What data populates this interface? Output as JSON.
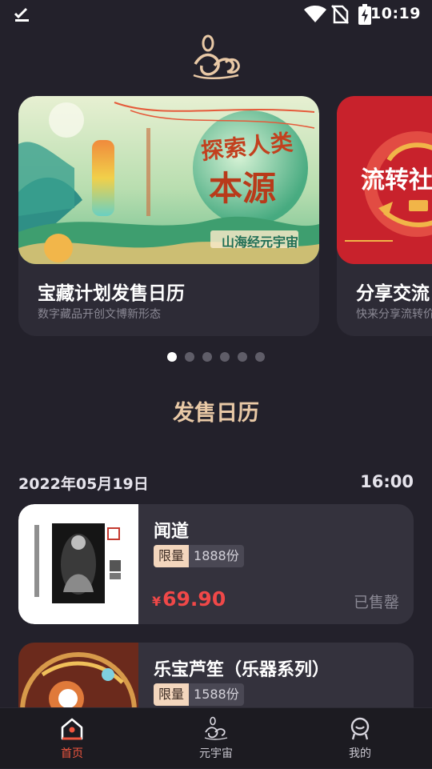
{
  "status_bar": {
    "time": "10:19"
  },
  "carousel": {
    "cards": [
      {
        "title": "宝藏计划发售日历",
        "subtitle": "数字藏品开创文博新形态",
        "banner_line1": "探索人类",
        "banner_line2": "本源",
        "banner_caption": "山海经元宇宙"
      },
      {
        "title": "分享交流",
        "subtitle": "快来分享流转价",
        "banner_line1": "流转社"
      }
    ],
    "page_count": 6,
    "active_index": 0
  },
  "section": {
    "title": "发售日历"
  },
  "schedule": {
    "date": "2022年05月19日",
    "time": "16:00"
  },
  "products": [
    {
      "name": "闻道",
      "limit_tag": "限量",
      "quantity": "1888份",
      "currency": "¥",
      "price": "69.90",
      "status": "已售罄"
    },
    {
      "name": "乐宝芦笙（乐器系列）",
      "limit_tag": "限量",
      "quantity": "1588份"
    }
  ],
  "tabbar": {
    "tabs": [
      {
        "label": "首页",
        "icon": "home-icon"
      },
      {
        "label": "元宇宙",
        "icon": "metaverse-logo-icon"
      },
      {
        "label": "我的",
        "icon": "profile-icon"
      }
    ],
    "active_color": "#f0563f"
  },
  "colors": {
    "background": "#23212b",
    "accent_gold": "#e9c9a6",
    "price_red": "#f04848"
  }
}
